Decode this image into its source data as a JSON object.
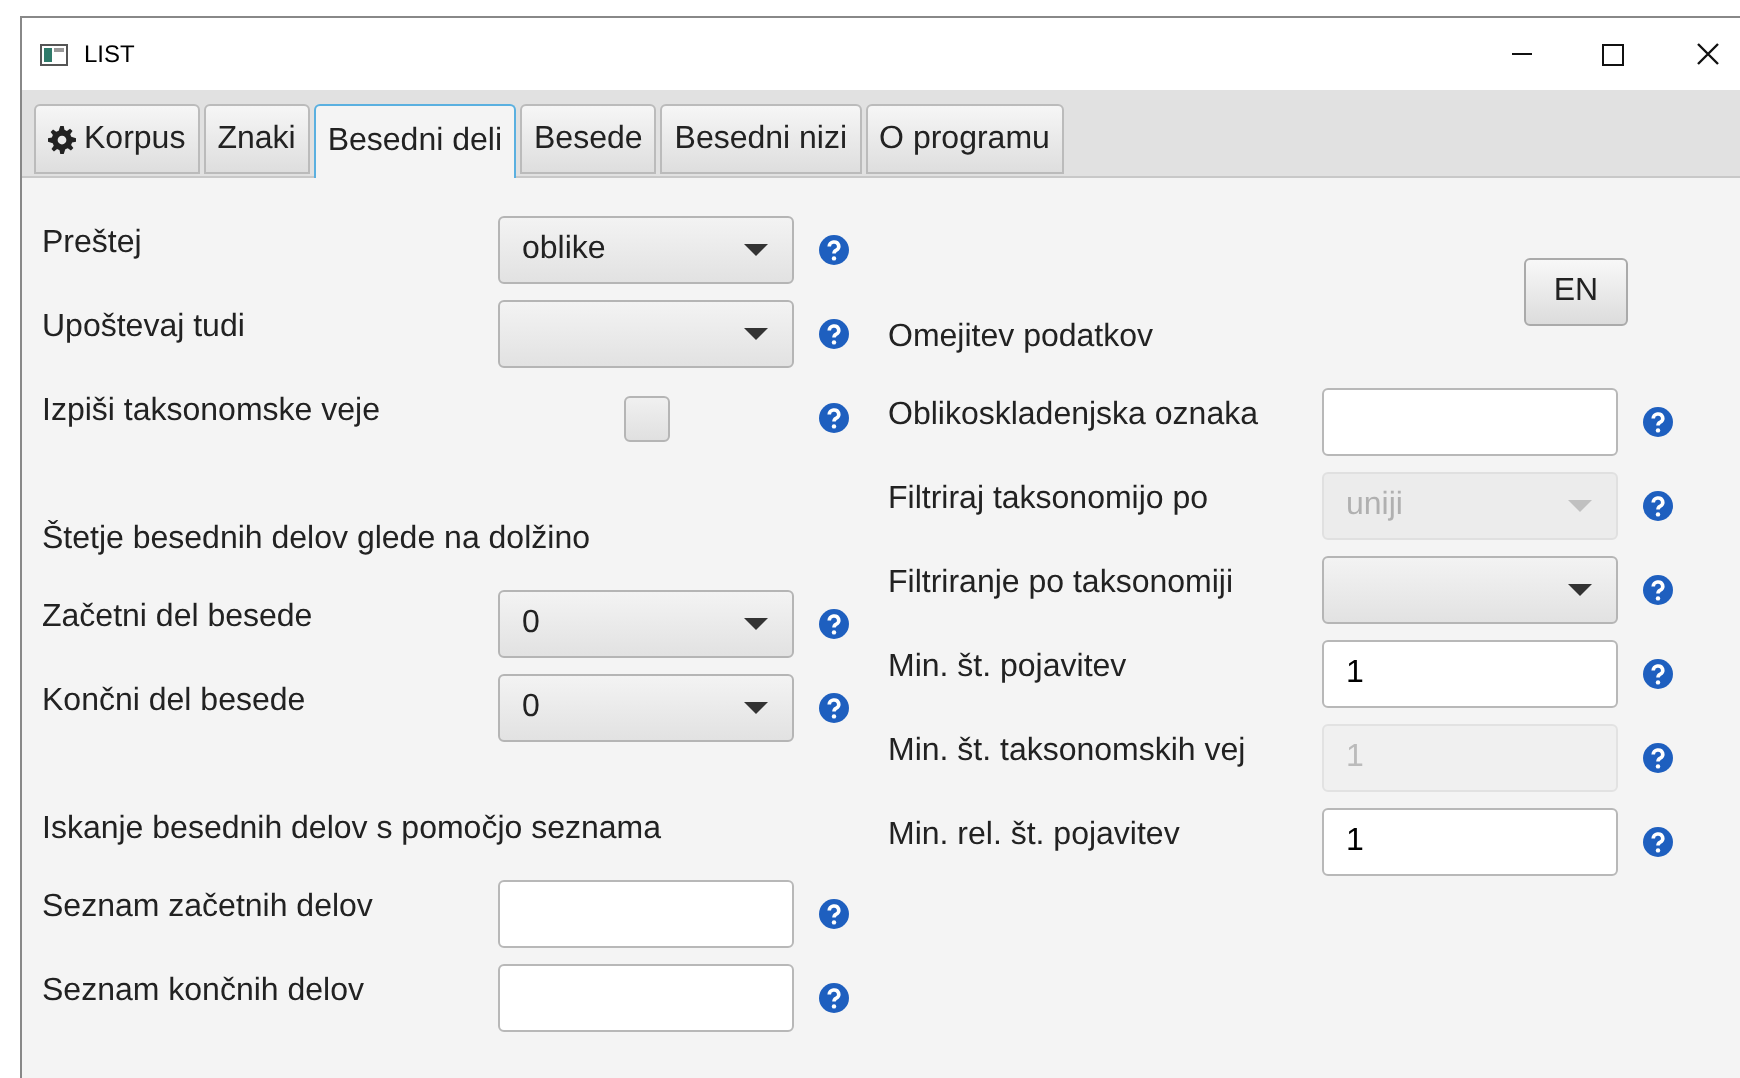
{
  "window": {
    "title": "LIST"
  },
  "tabs": [
    {
      "label": "Korpus",
      "selected": false,
      "kind": "with_gear"
    },
    {
      "label": "Znaki",
      "selected": false
    },
    {
      "label": "Besedni deli",
      "selected": true
    },
    {
      "label": "Besede",
      "selected": false
    },
    {
      "label": "Besedni nizi",
      "selected": false
    },
    {
      "label": "O programu",
      "selected": false
    }
  ],
  "language_button": "EN",
  "left_rows": [
    {
      "kind": "dropdown",
      "label": "Preštej",
      "value": "oblike",
      "disabled": false
    },
    {
      "kind": "dropdown",
      "label": "Upoštevaj tudi",
      "disabled": false
    },
    {
      "kind": "checkbox",
      "label": "Izpiši taksonomske veje",
      "checked": false
    },
    {
      "kind": "heading",
      "label": "Štetje besednih delov glede na dolžino"
    },
    {
      "kind": "dropdown",
      "label": "Začetni del besede",
      "value": "0",
      "disabled": false
    },
    {
      "kind": "dropdown",
      "label": "Končni del besede",
      "value": "0",
      "disabled": false
    },
    {
      "kind": "heading",
      "label": "Iskanje besednih delov s pomočjo seznama"
    },
    {
      "kind": "text_field",
      "label": "Seznam začetnih delov",
      "disabled": false
    },
    {
      "kind": "text_field",
      "label": "Seznam končnih delov",
      "disabled": false
    }
  ],
  "right_rows": [
    {
      "kind": "heading",
      "label": "Omejitev podatkov"
    },
    {
      "kind": "text_field",
      "label": "Oblikoskladenjska oznaka",
      "disabled": false
    },
    {
      "kind": "dropdown",
      "label": "Filtriraj taksonomijo po",
      "value": "uniji",
      "disabled": true
    },
    {
      "kind": "dropdown",
      "label": "Filtriranje po taksonomiji",
      "disabled": false
    },
    {
      "kind": "text_field",
      "label": "Min. št. pojavitev",
      "value": "1",
      "disabled": false
    },
    {
      "kind": "text_field",
      "label": "Min. št. taksonomskih vej",
      "value": "1",
      "disabled": true
    },
    {
      "kind": "text_field",
      "label": "Min. rel. št. pojavitev",
      "value": "1",
      "disabled": false
    }
  ]
}
